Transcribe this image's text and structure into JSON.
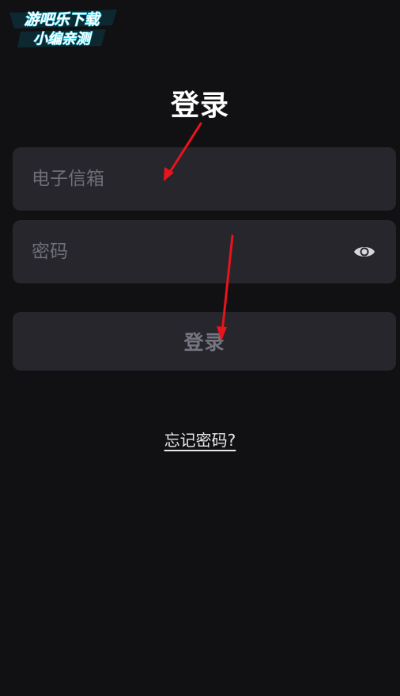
{
  "watermark": {
    "line1": "游吧乐下载",
    "line2": "小编亲测"
  },
  "header": {
    "title": "登录"
  },
  "form": {
    "email_placeholder": "电子信箱",
    "password_placeholder": "密码",
    "password_toggle_icon": "eye-icon",
    "submit_label": "登录"
  },
  "links": {
    "forgot_password": "忘记密码?"
  },
  "colors": {
    "background": "#111113",
    "field_background": "#26262c",
    "placeholder": "#6f6f78",
    "watermark_accent": "#22c8e6",
    "annotation_arrow": "#e8141c"
  }
}
